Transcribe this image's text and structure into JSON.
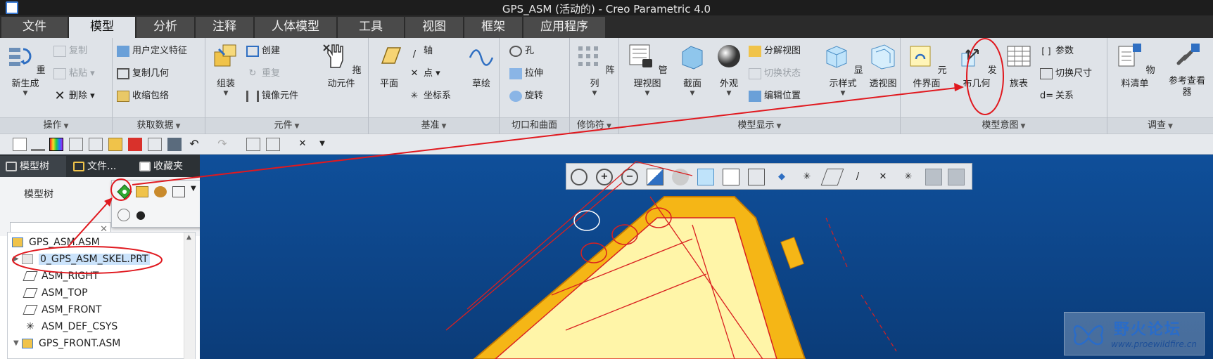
{
  "window": {
    "title": "GPS_ASM (活动的) - Creo Parametric 4.0"
  },
  "tabs": [
    {
      "label": "文件"
    },
    {
      "label": "模型"
    },
    {
      "label": "分析"
    },
    {
      "label": "注释"
    },
    {
      "label": "人体模型"
    },
    {
      "label": "工具"
    },
    {
      "label": "视图"
    },
    {
      "label": "框架"
    },
    {
      "label": "应用程序"
    }
  ],
  "ribbon": {
    "operations": {
      "label": "操作",
      "regenerate": "重新生成",
      "copy": "复制",
      "paste": "粘贴",
      "delete": "删除"
    },
    "get_data": {
      "label": "获取数据",
      "udf": "用户定义特征",
      "copy_geom": "复制几何",
      "shrinkwrap": "收缩包络"
    },
    "component": {
      "label": "元件",
      "assemble": "组装",
      "create": "创建",
      "repeat": "重复",
      "mirror": "镜像元件",
      "drag": "拖动元件"
    },
    "datum": {
      "label": "基准",
      "plane": "平面",
      "axis": "轴",
      "point": "点",
      "csys": "坐标系",
      "sketch": "草绘"
    },
    "cut_surface": {
      "label": "切口和曲面",
      "hole": "孔",
      "extrude": "拉伸",
      "revolve": "旋转"
    },
    "modifiers": {
      "label": "修饰符",
      "pattern": "阵列"
    },
    "model_display": {
      "label": "模型显示",
      "manage_views": "管理视图",
      "section": "截面",
      "appearance": "外观",
      "explode": "分解视图",
      "toggle_status": "切换状态",
      "edit_position": "编辑位置",
      "display_style": "显示样式",
      "perspective": "透视图"
    },
    "model_intent": {
      "label": "模型意图",
      "component_interface": "元件界面",
      "publish_geom": "发布几何",
      "family_table": "族表",
      "parameters": "参数",
      "switch_dims": "切换尺寸",
      "relations": "关系"
    },
    "investigate": {
      "label": "调查",
      "bom": "物料清单",
      "ref_viewer": "参考查看器"
    }
  },
  "left_panel": {
    "tabs": [
      {
        "label": "模型树"
      },
      {
        "label": "文件..."
      },
      {
        "label": "收藏夹"
      }
    ],
    "header": "模型树",
    "tree": [
      {
        "label": "GPS_ASM.ASM"
      },
      {
        "label": "0_GPS_ASM_SKEL.PRT"
      },
      {
        "label": "ASM_RIGHT"
      },
      {
        "label": "ASM_TOP"
      },
      {
        "label": "ASM_FRONT"
      },
      {
        "label": "ASM_DEF_CSYS"
      },
      {
        "label": "GPS_FRONT.ASM"
      }
    ]
  },
  "watermark": {
    "title": "野火论坛",
    "url": "www.proewildfire.cn"
  },
  "colors": {
    "annotation_red": "#e0191f",
    "viewport_blue": "#0f4f9a",
    "part_yellow": "#f5b616",
    "part_light": "#fff5a8"
  }
}
